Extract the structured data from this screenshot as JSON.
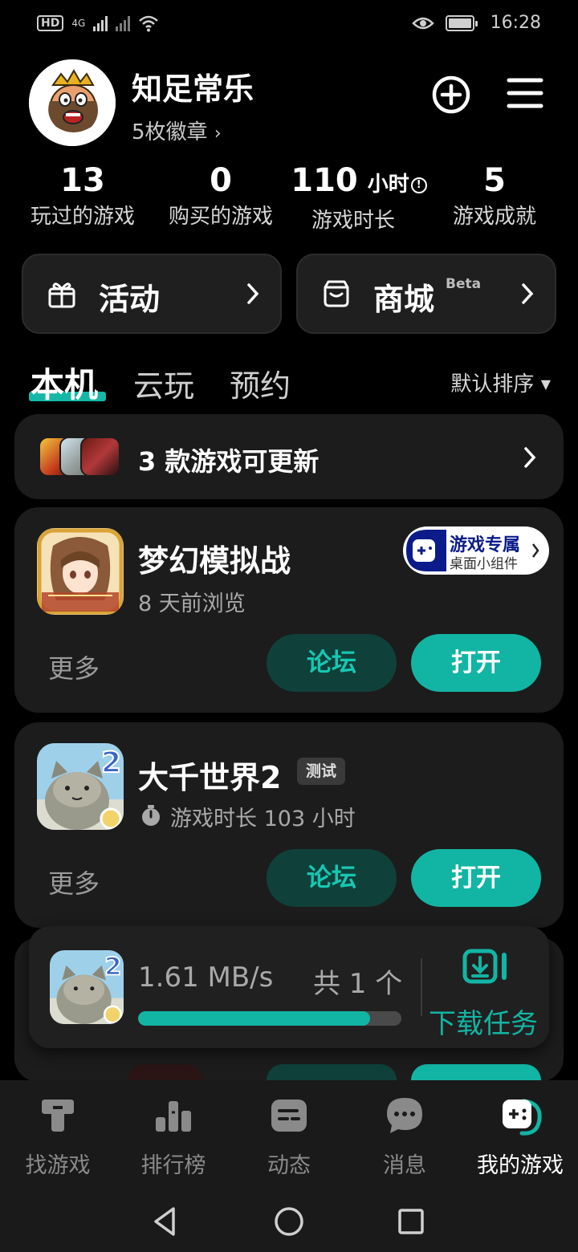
{
  "status_bar": {
    "network_label": "HD",
    "signal_label": "4G",
    "time": "16:28",
    "icons": [
      "hd-icon",
      "signal-icon",
      "signal-icon",
      "wifi-icon",
      "eye-icon",
      "battery-icon"
    ]
  },
  "profile": {
    "username": "知足常乐",
    "badges_text": "5枚徽章",
    "add_icon": "plus-circle-icon",
    "menu_icon": "hamburger-menu-icon"
  },
  "stats": [
    {
      "value": "13",
      "unit": "",
      "label": "玩过的游戏"
    },
    {
      "value": "0",
      "unit": "",
      "label": "购买的游戏"
    },
    {
      "value": "110",
      "unit": "小时",
      "label": "游戏时长"
    },
    {
      "value": "5",
      "unit": "",
      "label": "游戏成就"
    }
  ],
  "quick_links": [
    {
      "label": "活动",
      "icon": "gift-icon",
      "tag": ""
    },
    {
      "label": "商城",
      "icon": "store-icon",
      "tag": "Beta"
    }
  ],
  "tabs": {
    "items": [
      "本机",
      "云玩",
      "预约"
    ],
    "active": "本机",
    "sort_label": "默认排序"
  },
  "updates": {
    "text": "3 款游戏可更新"
  },
  "games": [
    {
      "title": "梦幻模拟战",
      "subtitle": "8 天前浏览",
      "widget_title": "游戏专属",
      "widget_subtitle": "桌面小组件",
      "more": "更多",
      "forum": "论坛",
      "open": "打开"
    },
    {
      "title": "大千世界2",
      "badge": "测试",
      "subtitle": "游戏时长 103 小时",
      "more": "更多",
      "forum": "论坛",
      "open": "打开"
    }
  ],
  "download": {
    "speed": "1.61 MB/s",
    "count": "共 1 个",
    "progress": 0.88,
    "task_label": "下载任务"
  },
  "bottom_nav": {
    "items": [
      {
        "label": "找游戏",
        "icon": "taptap-icon"
      },
      {
        "label": "排行榜",
        "icon": "ranking-icon"
      },
      {
        "label": "动态",
        "icon": "feed-icon"
      },
      {
        "label": "消息",
        "icon": "message-icon"
      },
      {
        "label": "我的游戏",
        "icon": "gamepad-icon"
      }
    ],
    "active": "我的游戏"
  },
  "colors": {
    "accent": "#12b5a3",
    "background": "#000000",
    "card": "#1c1c1c"
  }
}
